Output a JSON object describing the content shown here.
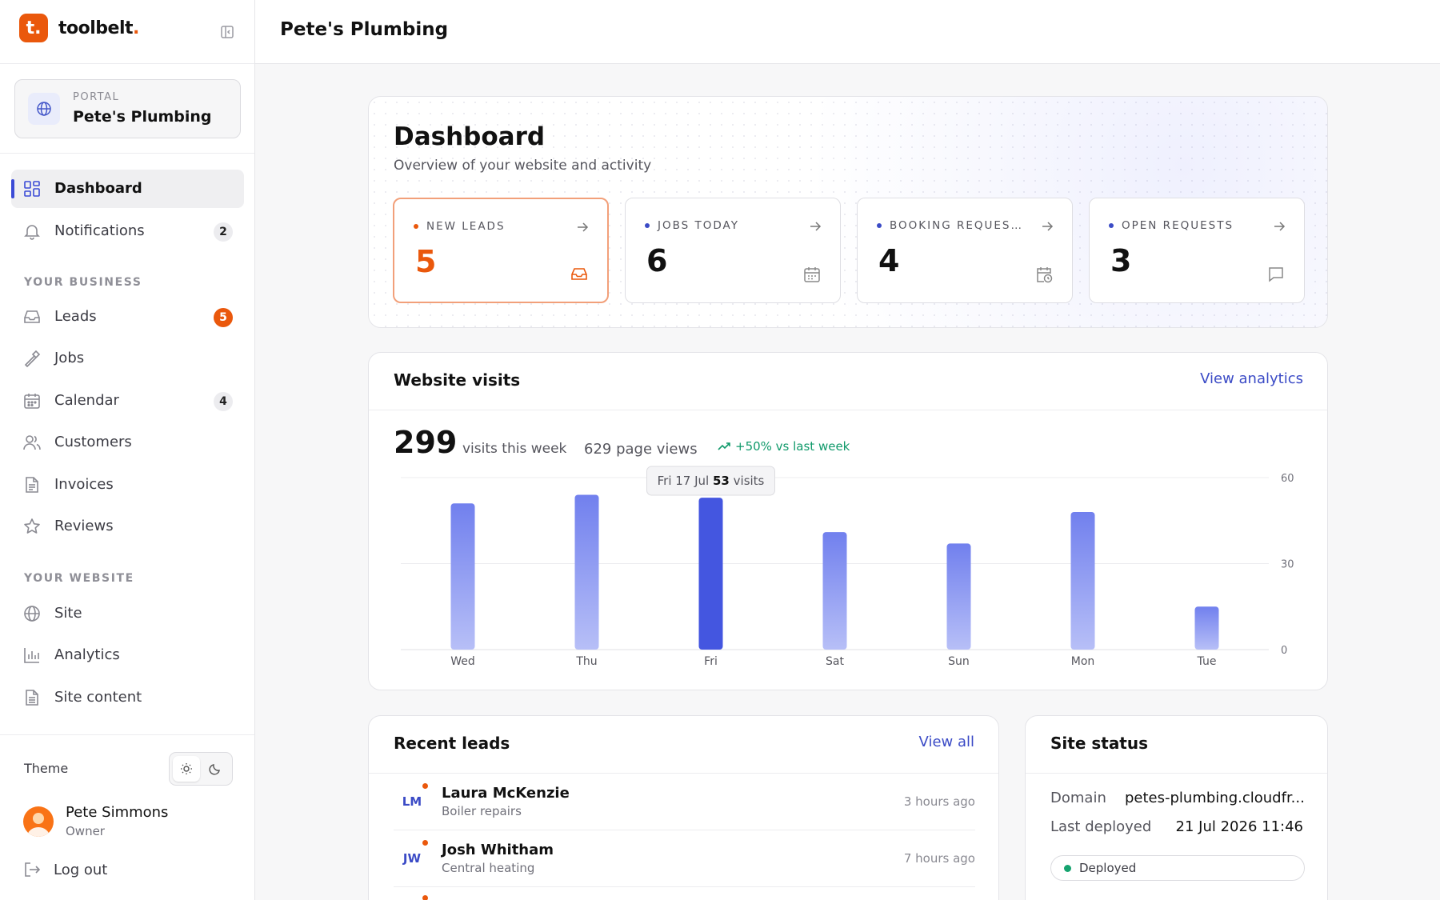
{
  "brand": {
    "name": "toolbelt",
    "dot": ".",
    "logo_letter": "t."
  },
  "portal": {
    "kicker": "PORTAL",
    "name": "Pete's Plumbing"
  },
  "nav_main": [
    {
      "label": "Dashboard",
      "icon": "grid-icon",
      "badge": ""
    },
    {
      "label": "Notifications",
      "icon": "bell-icon",
      "badge": "2"
    }
  ],
  "sections": {
    "business": "YOUR BUSINESS",
    "website": "YOUR WEBSITE"
  },
  "nav_business": [
    {
      "label": "Leads",
      "icon": "inbox-icon",
      "badge": "5"
    },
    {
      "label": "Jobs",
      "icon": "hammer-icon",
      "badge": ""
    },
    {
      "label": "Calendar",
      "icon": "calendar-icon",
      "badge": "4"
    },
    {
      "label": "Customers",
      "icon": "users-icon",
      "badge": ""
    },
    {
      "label": "Invoices",
      "icon": "file-icon",
      "badge": ""
    },
    {
      "label": "Reviews",
      "icon": "star-icon",
      "badge": ""
    }
  ],
  "nav_website": [
    {
      "label": "Site",
      "icon": "globe-icon"
    },
    {
      "label": "Analytics",
      "icon": "bar-chart-icon"
    },
    {
      "label": "Site content",
      "icon": "file-text-icon"
    }
  ],
  "theme": {
    "label": "Theme",
    "active": "light"
  },
  "user": {
    "name": "Pete Simmons",
    "role": "Owner"
  },
  "logout_label": "Log out",
  "topbar": {
    "title": "Pete's Plumbing"
  },
  "hero": {
    "title": "Dashboard",
    "subtitle": "Overview of your website and activity",
    "stats": [
      {
        "label": "NEW LEADS",
        "value": "5",
        "icon": "inbox-icon",
        "dot_color": "#ea580c"
      },
      {
        "label": "JOBS TODAY",
        "value": "6",
        "icon": "calendar-icon",
        "dot_color": "#3b4bc6"
      },
      {
        "label": "BOOKING REQUES…",
        "value": "4",
        "icon": "calendar-clock-icon",
        "dot_color": "#3b4bc6"
      },
      {
        "label": "OPEN REQUESTS",
        "value": "3",
        "icon": "message-icon",
        "dot_color": "#3b4bc6"
      }
    ]
  },
  "visits": {
    "title": "Website visits",
    "link": "View analytics",
    "count": "299",
    "count_unit": "visits this week",
    "page_views": "629 page views",
    "trend": "+50% vs last week",
    "tooltip": {
      "date": "Fri 17 Jul",
      "value": "53",
      "unit": "visits"
    }
  },
  "chart_data": {
    "type": "bar",
    "categories": [
      "Wed",
      "Thu",
      "Fri",
      "Sat",
      "Sun",
      "Mon",
      "Tue"
    ],
    "values": [
      51,
      54,
      53,
      41,
      37,
      48,
      15
    ],
    "highlight_index": 2,
    "ylim": [
      0,
      60
    ],
    "yticks": [
      0,
      30,
      60
    ],
    "grid": true,
    "colors": {
      "bar_top": "#7180ee",
      "bar_bottom": "#b7bff7",
      "highlight": "#4456e0"
    }
  },
  "leads": {
    "title": "Recent leads",
    "link": "View all",
    "rows": [
      {
        "initials": "LM",
        "name": "Laura McKenzie",
        "job": "Boiler repairs",
        "time": "3 hours ago"
      },
      {
        "initials": "JW",
        "name": "Josh Whitham",
        "job": "Central heating",
        "time": "7 hours ago"
      }
    ]
  },
  "site_status": {
    "title": "Site status",
    "domain_label": "Domain",
    "domain_value": "petes-plumbing.cloudfr...",
    "deployed_label": "Last deployed",
    "deployed_value": "21 Jul 2026 11:46",
    "status": "Deployed"
  }
}
